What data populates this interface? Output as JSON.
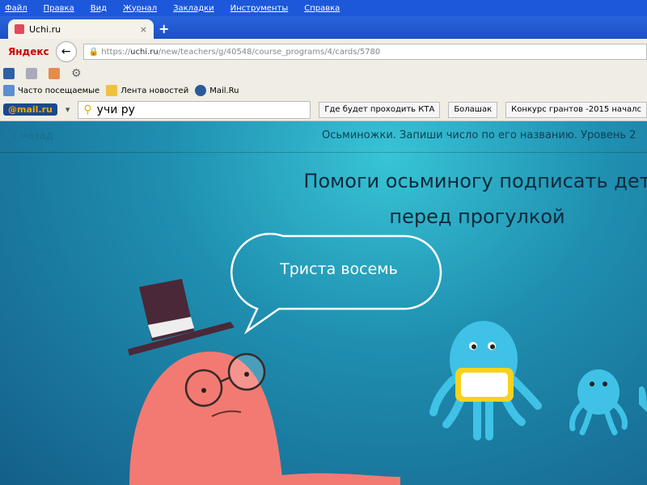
{
  "menu": [
    "Файл",
    "Правка",
    "Вид",
    "Журнал",
    "Закладки",
    "Инструменты",
    "Справка"
  ],
  "tab": {
    "title": "Uchi.ru",
    "close": "×",
    "new_tab": "+"
  },
  "nav": {
    "yandex": "Яндекс",
    "back": "←",
    "url_prefix": "https://",
    "url_host": "uchi.ru",
    "url_path": "/new/teachers/g/40548/course_programs/4/cards/5780"
  },
  "bookmarks": [
    "Часто посещаемые",
    "Лента новостей",
    "Mail.Ru"
  ],
  "mailbar": {
    "logo": "@mail.ru",
    "search_value": "учи ру",
    "quick": [
      "Где будет проходить КТА",
      "Болашак",
      "Конкурс грантов -2015 началс"
    ]
  },
  "page": {
    "back": "назад",
    "lesson_title": "Осьминожки. Запиши число по его названию. Уровень 2",
    "heading_line1": "Помоги осьминогу подписать дет",
    "heading_line2": "перед прогулкой",
    "bubble": "Триста восемь"
  }
}
